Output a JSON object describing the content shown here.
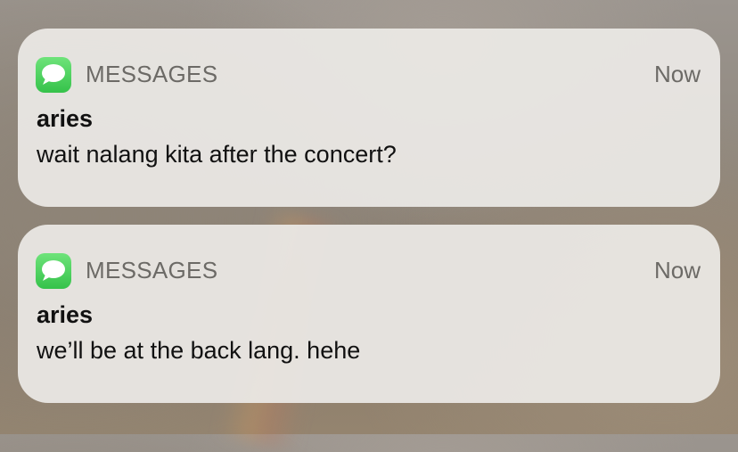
{
  "notifications": [
    {
      "app_name": "MESSAGES",
      "time": "Now",
      "sender": "aries",
      "message": "wait nalang kita after the concert?"
    },
    {
      "app_name": "MESSAGES",
      "time": "Now",
      "sender": "aries",
      "message": "we’ll be at the back lang. hehe"
    }
  ],
  "icons": {
    "app_icon": "messages-icon"
  },
  "colors": {
    "messages_green": "#4cd964",
    "notification_bg": "#ecebe7"
  }
}
